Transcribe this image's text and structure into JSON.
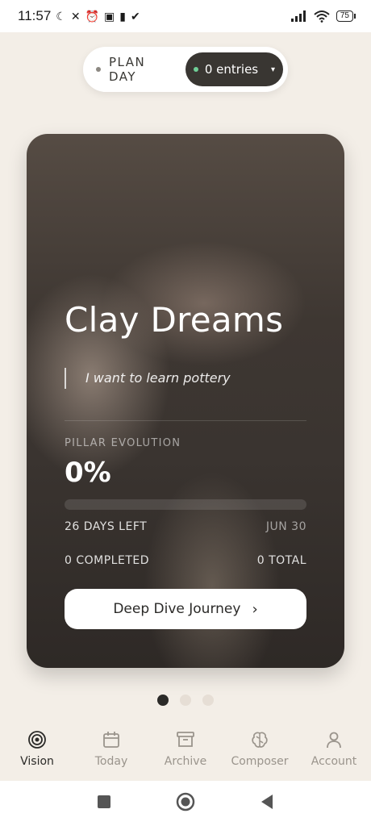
{
  "status_bar": {
    "time": "11:57",
    "battery": "75"
  },
  "top": {
    "plan_label": "PLAN DAY",
    "entries_label": "0 entries"
  },
  "card": {
    "title": "Clay Dreams",
    "quote": "I want to learn pottery",
    "pillar_label": "PILLAR EVOLUTION",
    "pillar_value": "0%",
    "progress": 0,
    "days_left": "26 DAYS LEFT",
    "due_date": "JUN 30",
    "completed": "0 COMPLETED",
    "total": "0 TOTAL",
    "cta_label": "Deep Dive Journey"
  },
  "pager": {
    "count": 3,
    "active": 0
  },
  "nav": {
    "items": [
      {
        "label": "Vision",
        "icon": "target-icon",
        "active": true
      },
      {
        "label": "Today",
        "icon": "calendar-icon",
        "active": false
      },
      {
        "label": "Archive",
        "icon": "archive-box-icon",
        "active": false
      },
      {
        "label": "Composer",
        "icon": "brain-icon",
        "active": false
      },
      {
        "label": "Account",
        "icon": "user-icon",
        "active": false
      }
    ]
  },
  "colors": {
    "background": "#f3eee7",
    "accent_dark": "#393632",
    "status_green": "#6fcf97"
  }
}
